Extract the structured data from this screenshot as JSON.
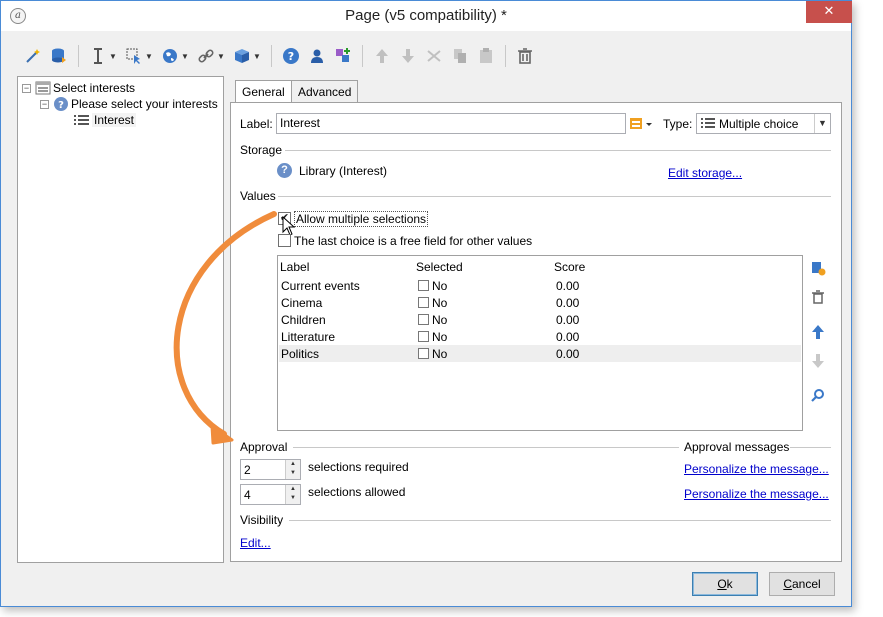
{
  "window": {
    "title": "Page (v5 compatibility) *"
  },
  "tree": {
    "items": [
      {
        "label": "Select interests"
      },
      {
        "label": "Please select your interests"
      },
      {
        "label": "Interest"
      }
    ]
  },
  "tabs": [
    {
      "label": "General"
    },
    {
      "label": "Advanced"
    }
  ],
  "form": {
    "label_caption": "Label:",
    "label_value": "Interest",
    "type_caption": "Type:",
    "type_value": "Multiple choice"
  },
  "storage": {
    "heading": "Storage",
    "value": "Library (Interest)",
    "edit_link": "Edit storage..."
  },
  "values": {
    "heading": "Values",
    "allow_multiple": {
      "label": "Allow multiple selections",
      "checked": true
    },
    "free_field": {
      "label": "The last choice is a free field for other values",
      "checked": false
    },
    "columns": [
      "Label",
      "Selected",
      "Score"
    ],
    "rows": [
      {
        "label": "Current events",
        "selected": "No",
        "score": "0.00"
      },
      {
        "label": "Cinema",
        "selected": "No",
        "score": "0.00"
      },
      {
        "label": "Children",
        "selected": "No",
        "score": "0.00"
      },
      {
        "label": "Litterature",
        "selected": "No",
        "score": "0.00"
      },
      {
        "label": "Politics",
        "selected": "No",
        "score": "0.00"
      }
    ]
  },
  "approval": {
    "heading": "Approval",
    "messages_heading": "Approval messages",
    "required_value": "2",
    "required_label": "selections required",
    "allowed_value": "4",
    "allowed_label": "selections allowed",
    "personalize_link_1": "Personalize the message...",
    "personalize_link_2": "Personalize the message..."
  },
  "visibility": {
    "heading": "Visibility",
    "edit_link": "Edit..."
  },
  "buttons": {
    "ok": "Ok",
    "cancel": "Cancel"
  },
  "colors": {
    "accent_arrow": "#f08c3c",
    "link": "#0000cc",
    "close_button": "#c7504c"
  }
}
